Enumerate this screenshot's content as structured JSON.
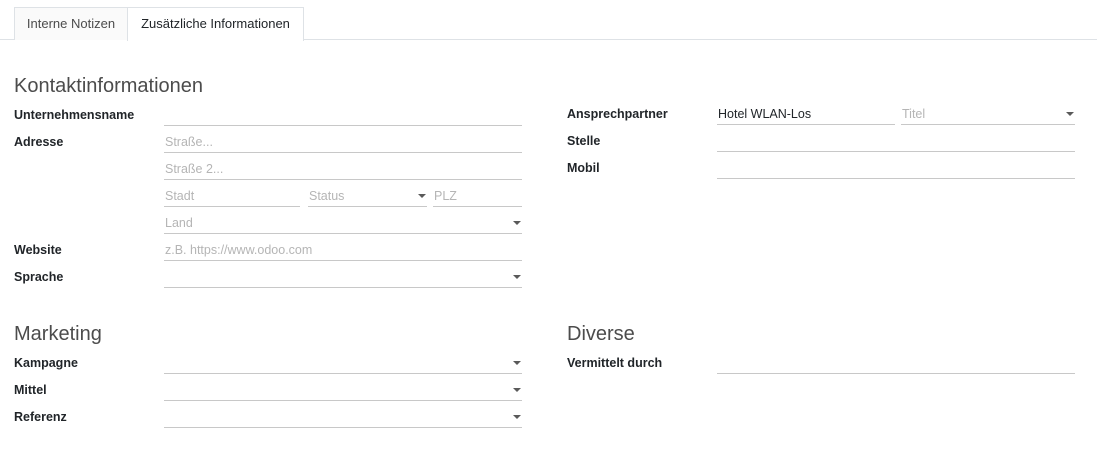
{
  "tabs": [
    {
      "label": "Interne Notizen"
    },
    {
      "label": "Zusätzliche Informationen"
    }
  ],
  "contact": {
    "title": "Kontaktinformationen",
    "company_label": "Unternehmensname",
    "company_value": "",
    "address_label": "Adresse",
    "street_placeholder": "Straße...",
    "street2_placeholder": "Straße 2...",
    "city_placeholder": "Stadt",
    "state_placeholder": "Status",
    "zip_placeholder": "PLZ",
    "country_placeholder": "Land",
    "website_label": "Website",
    "website_placeholder": "z.B. https://www.odoo.com",
    "language_label": "Sprache",
    "language_value": ""
  },
  "contact_right": {
    "contact_person_label": "Ansprechpartner",
    "contact_person_value": "Hotel WLAN-Los",
    "title_placeholder": "Titel",
    "job_label": "Stelle",
    "job_value": "",
    "mobile_label": "Mobil",
    "mobile_value": ""
  },
  "marketing": {
    "title": "Marketing",
    "campaign_label": "Kampagne",
    "medium_label": "Mittel",
    "source_label": "Referenz"
  },
  "misc": {
    "title": "Diverse",
    "referred_label": "Vermittelt durch",
    "referred_value": ""
  }
}
